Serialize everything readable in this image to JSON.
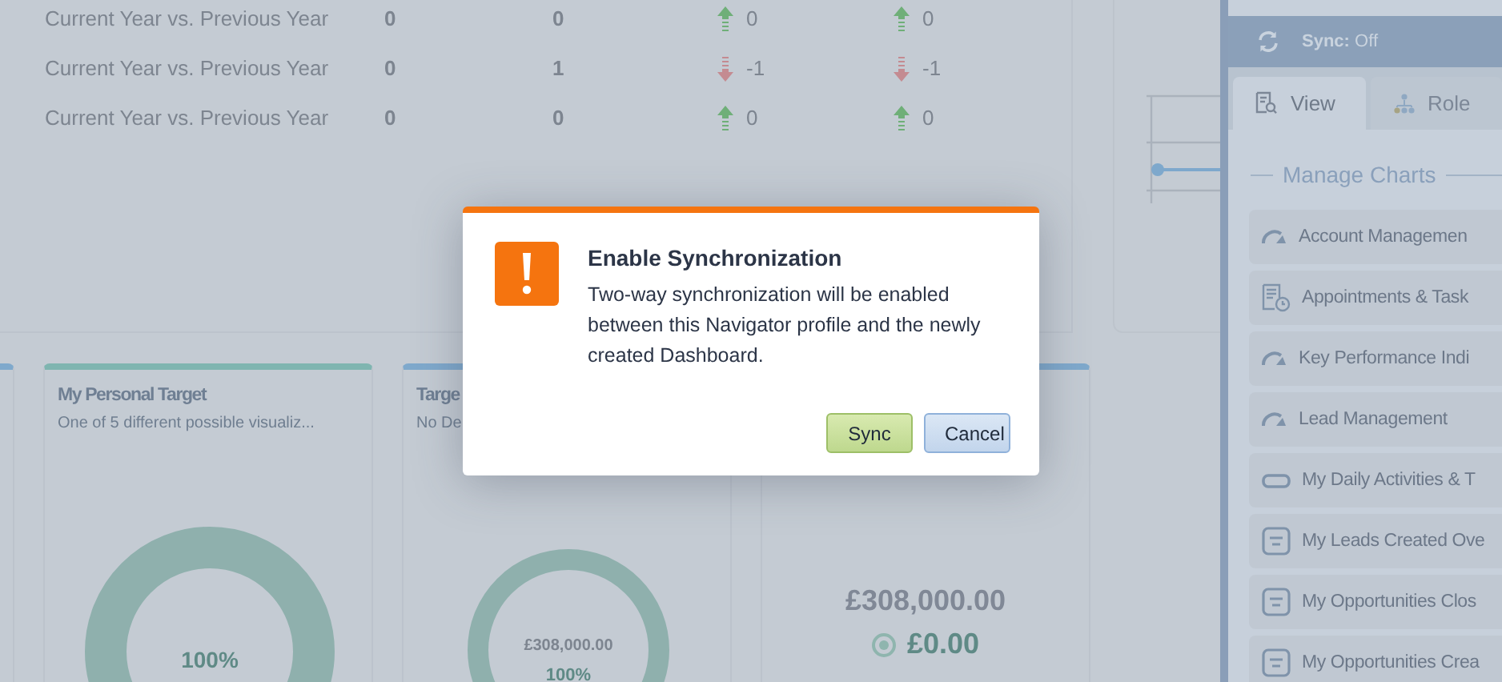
{
  "comparison_rows": [
    {
      "label": "Current Year vs. Previous Year",
      "value_1": "0",
      "value_2": "0",
      "trend_1": {
        "kind": "up",
        "value": "0"
      },
      "trend_2": {
        "kind": "up",
        "value": "0"
      }
    },
    {
      "label": "Current Year vs. Previous Year",
      "value_1": "0",
      "value_2": "1",
      "trend_1": {
        "kind": "down",
        "value": "-1"
      },
      "trend_2": {
        "kind": "down",
        "value": "-1"
      }
    },
    {
      "label": "Current Year vs. Previous Year",
      "value_1": "0",
      "value_2": "0",
      "trend_1": {
        "kind": "up",
        "value": "0"
      },
      "trend_2": {
        "kind": "up",
        "value": "0"
      }
    }
  ],
  "cards": [
    {
      "kind": "ring",
      "title": "My Personal Target",
      "subtitle": "One of 5 different possible visualiz...",
      "color": "#7fb5b0",
      "ring_label": "100%"
    },
    {
      "kind": "ring",
      "title": "Targe",
      "subtitle": "No De",
      "color": "#7fa9cc",
      "ring_amount": "£308,000.00",
      "ring_label": "100%"
    },
    {
      "kind": "amount",
      "color": "#7fa9cc",
      "amount": "£308,000.00",
      "target": "£0.00"
    }
  ],
  "side_panel": {
    "sync_label": "Sync:",
    "sync_state": "Off",
    "tabs": [
      {
        "label": "View",
        "selected": true
      },
      {
        "label": "Role",
        "selected": false
      }
    ],
    "section_title": "Manage Charts",
    "charts": [
      {
        "kind": "gauge",
        "label": "Account Managemen"
      },
      {
        "kind": "calendar",
        "label": "Appointments & Task"
      },
      {
        "kind": "gauge",
        "label": "Key Performance Indi"
      },
      {
        "kind": "gauge",
        "label": "Lead Management"
      },
      {
        "kind": "bar",
        "label": "My Daily Activities & T"
      },
      {
        "kind": "list",
        "label": "My Leads Created Ove"
      },
      {
        "kind": "list",
        "label": "My Opportunities Clos"
      },
      {
        "kind": "list",
        "label": "My Opportunities Crea"
      }
    ]
  },
  "dialog": {
    "title": "Enable Synchronization",
    "message": "Two-way synchronization will be enabled between this Navigator profile and the newly created Dashboard.",
    "buttons": [
      {
        "kind": "confirm",
        "label": "Sync"
      },
      {
        "kind": "cancel",
        "label": "Cancel"
      }
    ]
  }
}
